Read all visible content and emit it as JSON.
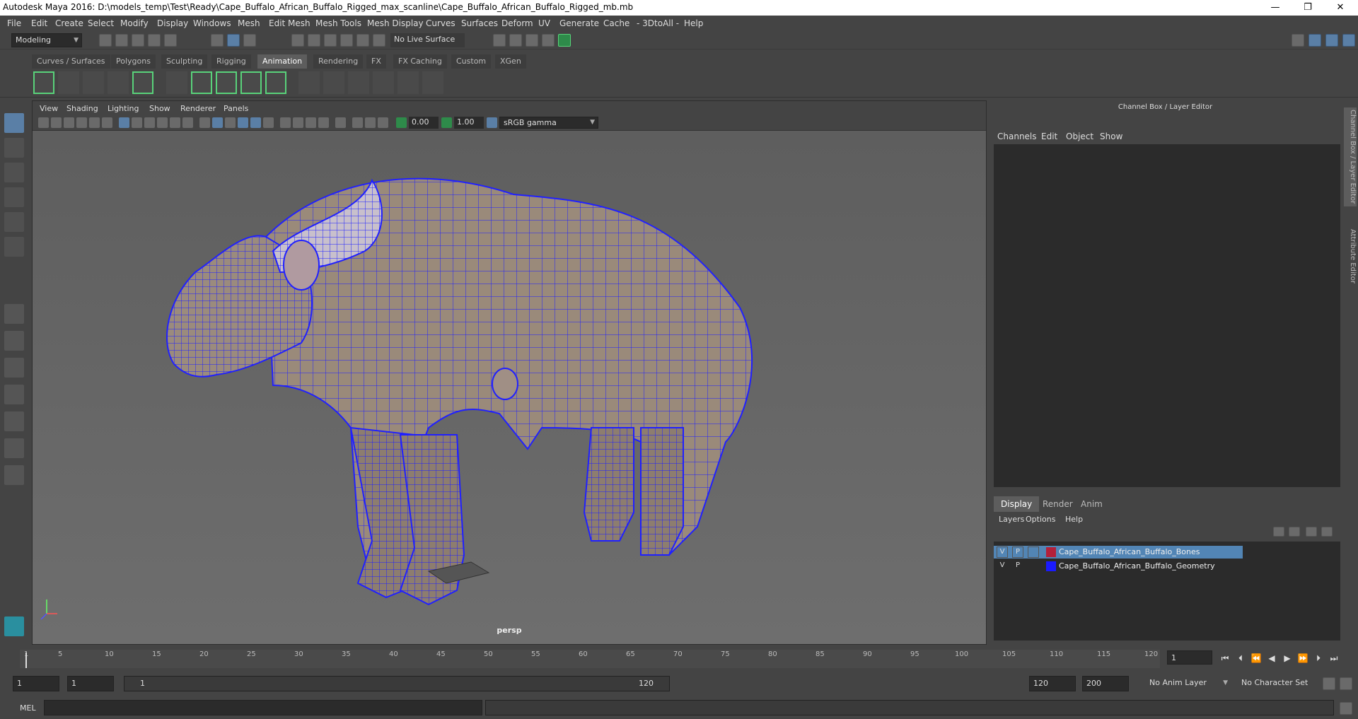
{
  "window": {
    "title": "Autodesk Maya 2016: D:\\models_temp\\Test\\Ready\\Cape_Buffalo_African_Buffalo_Rigged_max_scanline\\Cape_Buffalo_African_Buffalo_Rigged_mb.mb",
    "minimize": "—",
    "restore": "❐",
    "close": "✕"
  },
  "menubar": [
    "File",
    "Edit",
    "Create",
    "Select",
    "Modify",
    "Display",
    "Windows",
    "Mesh",
    "Edit Mesh",
    "Mesh Tools",
    "Mesh Display",
    "Curves",
    "Surfaces",
    "Deform",
    "UV",
    "Generate",
    "Cache",
    "- 3DtoAll -",
    "Help"
  ],
  "statusline": {
    "mode": "Modeling",
    "live_surface": "No Live Surface"
  },
  "shelf_tabs": [
    "Curves / Surfaces",
    "Polygons",
    "Sculpting",
    "Rigging",
    "Animation",
    "Rendering",
    "FX",
    "FX Caching",
    "Custom",
    "XGen"
  ],
  "active_shelf": "Animation",
  "viewport": {
    "menu": [
      "View",
      "Shading",
      "Lighting",
      "Show",
      "Renderer",
      "Panels"
    ],
    "exposure": "0.00",
    "gamma": "1.00",
    "color_space": "sRGB gamma",
    "camera": "persp"
  },
  "channel_box": {
    "title": "Channel Box / Layer Editor",
    "menu": [
      "Channels",
      "Edit",
      "Object",
      "Show"
    ],
    "layer_tabs": [
      "Display",
      "Render",
      "Anim"
    ],
    "active_layer_tab": "Display",
    "layer_menu": [
      "Layers",
      "Options",
      "Help"
    ],
    "layers": [
      {
        "v": "V",
        "p": "P",
        "color": "#b3203a",
        "name": "Cape_Buffalo_African_Buffalo_Bones",
        "selected": true
      },
      {
        "v": "V",
        "p": "P",
        "color": "#1a1aff",
        "name": "Cape_Buffalo_African_Buffalo_Geometry",
        "selected": false
      }
    ]
  },
  "side_tabs": [
    "Channel Box / Layer Editor",
    "Attribute Editor"
  ],
  "timeline": {
    "labels": [
      "1",
      "5",
      "10",
      "15",
      "20",
      "25",
      "30",
      "35",
      "40",
      "45",
      "50",
      "55",
      "60",
      "65",
      "70",
      "75",
      "80",
      "85",
      "90",
      "95",
      "100",
      "105",
      "110",
      "115",
      "120"
    ],
    "current_frame": "1"
  },
  "range": {
    "start": "1",
    "inner_start": "1",
    "slider_start": "1",
    "slider_end": "120",
    "end": "120",
    "max": "200",
    "anim_layer": "No Anim Layer",
    "char_set": "No Character Set"
  },
  "cmdline": {
    "label": "MEL"
  }
}
